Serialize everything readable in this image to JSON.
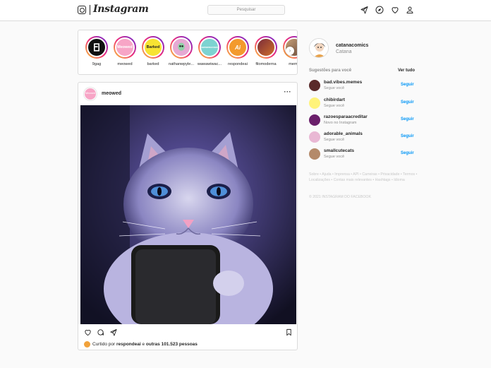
{
  "header": {
    "logo_text": "Instagram",
    "search_placeholder": "Pesquisar",
    "icons": [
      "send-icon",
      "compass-icon",
      "heart-icon",
      "profile-icon"
    ]
  },
  "stories": {
    "items": [
      {
        "username": "9gag",
        "avatar_text": "",
        "avatar_color": "#111111"
      },
      {
        "username": "meowed",
        "avatar_text": "Meowed",
        "avatar_color": "#f7a5c6"
      },
      {
        "username": "barked",
        "avatar_text": "Barked",
        "avatar_color": "#f7e332"
      },
      {
        "username": "nathanwpyle...",
        "avatar_text": "",
        "avatar_color": "#e6a9d3"
      },
      {
        "username": "wawawiwac...",
        "avatar_text": "WAWAWIWACOMICS",
        "avatar_color": "#7dd3d1"
      },
      {
        "username": "respondeai",
        "avatar_text": "Ai",
        "avatar_color": "#f39a2d"
      },
      {
        "username": "filomoderna",
        "avatar_text": "",
        "avatar_color": "#7a2b3a"
      },
      {
        "username": "meme",
        "avatar_text": "",
        "avatar_color": "#c9a27a"
      }
    ],
    "next_icon": "chevron-right-icon"
  },
  "post": {
    "username": "meowed",
    "avatar_text": "Meowed",
    "more_label": "···",
    "likes_prefix": "Curtido por",
    "likes_user": "respondeai",
    "likes_conj": "e",
    "likes_others": "outras 101.523 pessoas"
  },
  "sidebar": {
    "me": {
      "username": "catanacomics",
      "name": "Catana"
    },
    "suggestions_title": "Sugestões para você",
    "see_all": "Ver tudo",
    "suggestions": [
      {
        "username": "bad.vibes.memes",
        "sub": "Segue você",
        "follow": "Seguir",
        "color": "#5a2a2a"
      },
      {
        "username": "chibirdart",
        "sub": "Segue você",
        "follow": "Seguir",
        "color": "#fff37a"
      },
      {
        "username": "razoesparaacreditar",
        "sub": "Novo no Instagram",
        "follow": "Seguir",
        "color": "#6b1f6b"
      },
      {
        "username": "adorable_animals",
        "sub": "Segue você",
        "follow": "Seguir",
        "color": "#e9b8d4"
      },
      {
        "username": "smallcutecats",
        "sub": "Segue você",
        "follow": "Seguir",
        "color": "#b48a6a"
      }
    ],
    "footer_links": "Sobre • Ajuda • Imprensa • API • Carreiras • Privacidade • Termos • Localizações • Contas mais relevantes • Hashtags • Idioma",
    "copyright": "© 2021 INSTAGRAM DO FACEBOOK"
  }
}
